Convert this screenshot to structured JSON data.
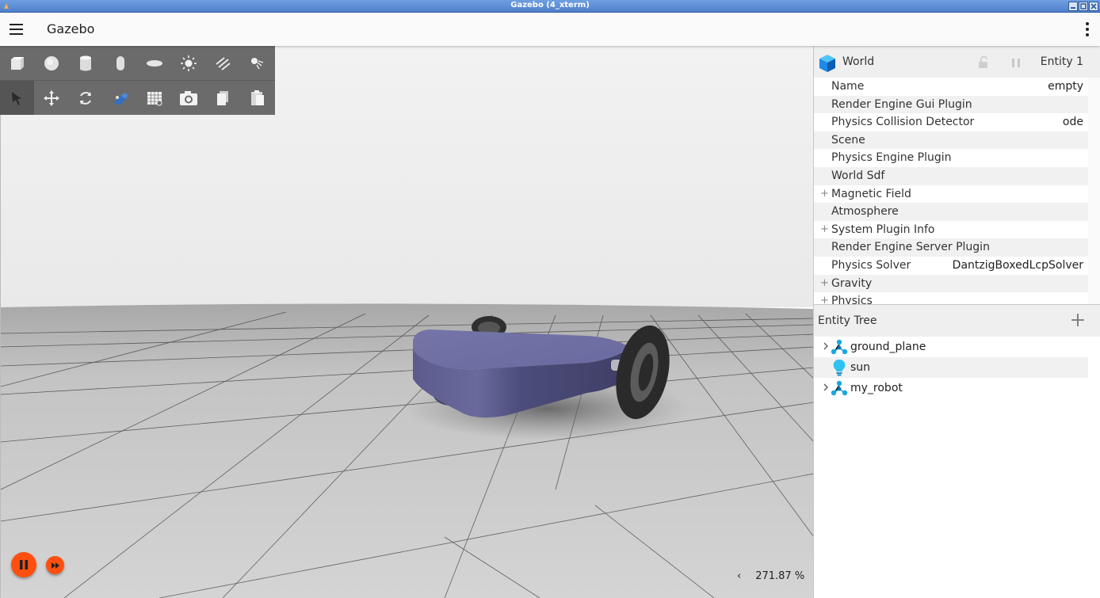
{
  "window": {
    "title": "Gazebo (4_xterm)"
  },
  "appbar": {
    "title": "Gazebo"
  },
  "toolbar": {
    "row1": [
      "box-icon",
      "sphere-icon",
      "cylinder-icon",
      "capsule-icon",
      "ellipsoid-icon",
      "sun-light-icon",
      "directional-light-icon",
      "spot-light-icon"
    ],
    "row2": [
      "select-icon",
      "translate-icon",
      "rotate-icon",
      "transform-icon",
      "grid-snap-icon",
      "screenshot-icon",
      "copy-icon",
      "paste-icon"
    ]
  },
  "status": {
    "rtf": "271.87 %",
    "chevron": "‹"
  },
  "component_inspector": {
    "entity_type": "World",
    "entity_id": "Entity 1",
    "properties": [
      {
        "key": "Name",
        "value": "empty",
        "expandable": false
      },
      {
        "key": "Render Engine Gui Plugin",
        "value": "",
        "expandable": false
      },
      {
        "key": "Physics Collision Detector",
        "value": "ode",
        "expandable": false
      },
      {
        "key": "Scene",
        "value": "",
        "expandable": false
      },
      {
        "key": "Physics Engine Plugin",
        "value": "",
        "expandable": false
      },
      {
        "key": "World Sdf",
        "value": "",
        "expandable": false
      },
      {
        "key": "Magnetic Field",
        "value": "",
        "expandable": true
      },
      {
        "key": "Atmosphere",
        "value": "",
        "expandable": false
      },
      {
        "key": "System Plugin Info",
        "value": "",
        "expandable": true
      },
      {
        "key": "Render Engine Server Plugin",
        "value": "",
        "expandable": false
      },
      {
        "key": "Physics Solver",
        "value": "DantzigBoxedLcpSolver",
        "expandable": false
      },
      {
        "key": "Gravity",
        "value": "",
        "expandable": true
      },
      {
        "key": "Physics",
        "value": "",
        "expandable": true
      }
    ],
    "expander_symbol": "+"
  },
  "entity_tree": {
    "title": "Entity Tree",
    "items": [
      {
        "name": "ground_plane",
        "icon": "model-icon",
        "expandable": true
      },
      {
        "name": "sun",
        "icon": "light-bulb-icon",
        "expandable": false
      },
      {
        "name": "my_robot",
        "icon": "model-icon",
        "expandable": true
      }
    ]
  },
  "colors": {
    "accent": "#ff4f10",
    "toolbar": "#6b6b6b",
    "robot_body": "#5d5d8e",
    "model_icon": "#1aa7e0"
  }
}
